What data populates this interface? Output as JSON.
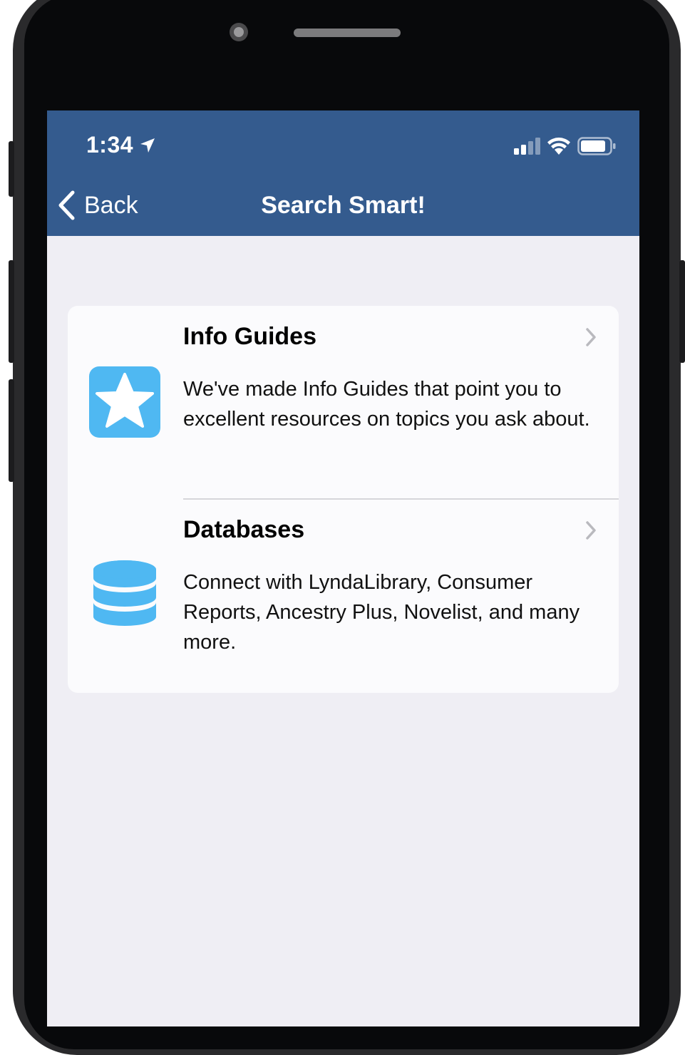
{
  "status_bar": {
    "time": "1:34",
    "icons": [
      "location-arrow-icon",
      "cellular-signal-icon",
      "wifi-icon",
      "battery-icon"
    ]
  },
  "nav": {
    "back_label": "Back",
    "title": "Search Smart!"
  },
  "colors": {
    "nav_bar": "#345b8e",
    "background": "#efeef4",
    "icon_accent": "#4fb8f2"
  },
  "list": {
    "items": [
      {
        "title": "Info Guides",
        "description": "We've made Info Guides that point you to excellent resources on topics you ask about.",
        "icon": "star-icon"
      },
      {
        "title": "Databases",
        "description": "Connect with LyndaLibrary, Consumer Reports, Ancestry Plus, Novelist, and many more.",
        "icon": "database-icon"
      }
    ]
  }
}
